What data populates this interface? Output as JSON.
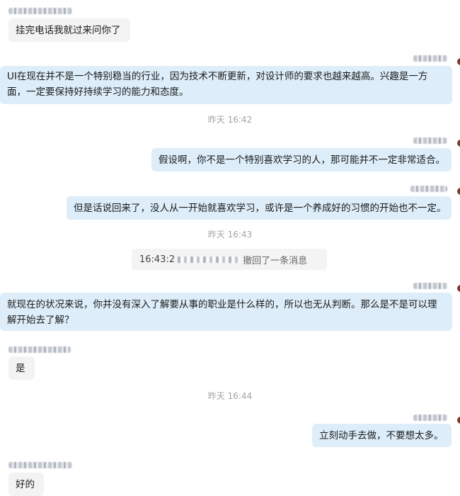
{
  "messages": [
    {
      "text": "挂完电话我就过来问你了"
    },
    {
      "text": "UI在现在并不是一个特别稳当的行业，因为技术不断更新，对设计师的要求也越来越高。兴趣是一方面，一定要保持好持续学习的能力和态度。"
    },
    {
      "text": "假设啊，你不是一个特别喜欢学习的人，那可能并不一定非常适合。"
    },
    {
      "text": "但是话说回来了，没人从一开始就喜欢学习，或许是一个养成好的习惯的开始也不一定。"
    },
    {
      "text": "就现在的状况来说，你并没有深入了解要从事的职业是什么样的，所以也无从判断。那么是不是可以理解开始去了解？"
    },
    {
      "text": "是"
    },
    {
      "text": "立刻动手去做，不要想太多。"
    },
    {
      "text": "好的"
    }
  ],
  "timestamps": [
    "昨天  16:42",
    "昨天  16:43",
    "昨天  16:44"
  ],
  "recall": {
    "time": "16:43:2",
    "text": "撤回了一条消息"
  }
}
